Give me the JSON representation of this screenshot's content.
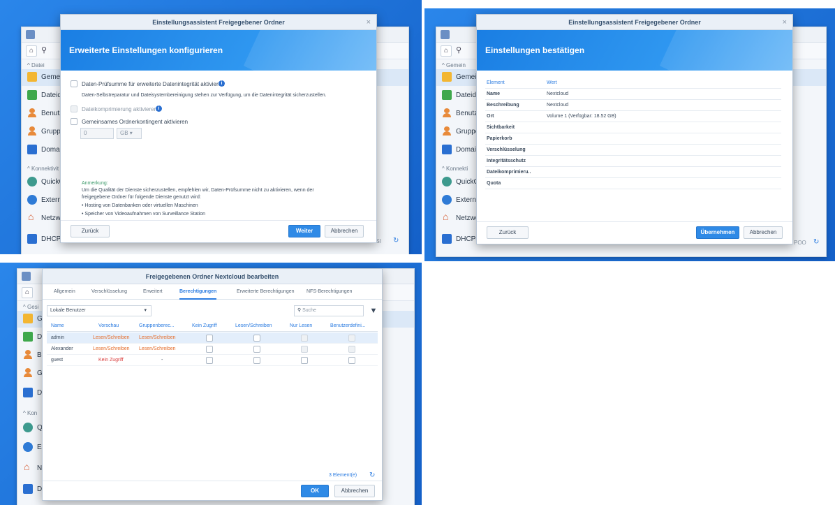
{
  "panel1": {
    "bg_sidebar": {
      "items": [
        "Gemein",
        "Dateidie",
        "Benutze",
        "Gruppe",
        "Domain",
        "QuickCo",
        "Externe",
        "Netzwe",
        "DHCP-Server"
      ],
      "sections": [
        "Datei",
        "Konnektivit"
      ]
    },
    "bg_footer_text": "PSI",
    "dialog": {
      "title": "Einstellungsassistent Freigegebener Ordner",
      "banner": "Erweiterte Einstellungen konfigurieren",
      "option1": "Daten-Prüfsumme für erweiterte Datenintegrität aktivieren",
      "option1_desc": "Daten-Selbstreparatur und Dateisystembereinigung stehen zur Verfügung, um die Datenintegrität sicherzustellen.",
      "option2": "Dateikomprimierung aktivieren",
      "option3": "Gemeinsames Ordnerkontingent aktivieren",
      "quota_value": "0",
      "quota_unit": "GB",
      "note_title": "Anmerkung:",
      "note_line1": "Um die Qualität der Dienste sicherzustellen, empfehlen wir, Daten-Prüfsumme nicht zu aktivieren, wenn der",
      "note_line2": "freigegebene Ordner für folgende Dienste genutzt wird:",
      "note_bullet1": "• Hosting von Datenbanken oder virtuellen Maschinen",
      "note_bullet2": "• Speicher von Videoaufnahmen von Surveillance Station",
      "back": "Zurück",
      "next": "Weiter",
      "cancel": "Abbrechen"
    }
  },
  "panel2": {
    "bg_sidebar": {
      "items": [
        "Gemein",
        "Dateidie",
        "Benutze",
        "Gruppe",
        "Domain",
        "QuickCo",
        "Externe",
        "Netzwe",
        "DHCP-Server"
      ],
      "sections": [
        "Gemein",
        "Konnekti"
      ]
    },
    "bg_footer_text": "POO",
    "dialog": {
      "title": "Einstellungsassistent Freigegebener Ordner",
      "banner": "Einstellungen bestätigen",
      "head_key": "Element",
      "head_val": "Wert",
      "rows": [
        {
          "k": "Name",
          "v": "Nextcloud"
        },
        {
          "k": "Beschreibung",
          "v": "Nextcloud"
        },
        {
          "k": "Ort",
          "v": "Volume 1 (Verfügbar: 18.52 GB)"
        },
        {
          "k": "Sichtbarkeit",
          "v": ""
        },
        {
          "k": "Papierkorb",
          "v": ""
        },
        {
          "k": "Verschlüsselung",
          "v": ""
        },
        {
          "k": "Integritätsschutz",
          "v": ""
        },
        {
          "k": "Dateikomprimieru..",
          "v": ""
        },
        {
          "k": "Quota",
          "v": ""
        }
      ],
      "back": "Zurück",
      "apply": "Übernehmen",
      "cancel": "Abbrechen"
    }
  },
  "panel3": {
    "bg_sidebar": {
      "items": [
        "Gem",
        "Da",
        "Be",
        "Gr",
        "Do",
        "Qu",
        "Ex",
        "Ne",
        "DH"
      ],
      "sections": [
        "Gesi",
        "Kon"
      ]
    },
    "dialog": {
      "title": "Freigegebenen Ordner Nextcloud bearbeiten",
      "tabs": [
        "Allgemein",
        "Verschlüsselung",
        "Erweitert",
        "Berechtigungen",
        "Erweiterte Berechtigungen",
        "NFS-Berechtigungen"
      ],
      "active_tab": 3,
      "user_select": "Lokale Benutzer",
      "search_placeholder": "Suche",
      "columns": [
        "Name",
        "Vorschau",
        "Gruppenberec...",
        "Kein Zugriff",
        "Lesen/Schreiben",
        "Nur Lesen",
        "Benutzerdefini..."
      ],
      "rows": [
        {
          "name": "admin",
          "preview": "Lesen/Schreiben",
          "group": "Lesen/Schreiben"
        },
        {
          "name": "Alexander",
          "preview": "Lesen/Schreiben",
          "group": "Lesen/Schreiben"
        },
        {
          "name": "guest",
          "preview": "Kein Zugriff",
          "group": "-"
        }
      ],
      "count": "3 Element(e)",
      "ok": "OK",
      "cancel": "Abbrechen"
    }
  },
  "colors": {
    "desktop": "#1b6fd8",
    "primary_button": "#2f8ae6",
    "link_blue": "#2a7be0",
    "orange": "#e46c2a",
    "red": "#d93c3c"
  }
}
